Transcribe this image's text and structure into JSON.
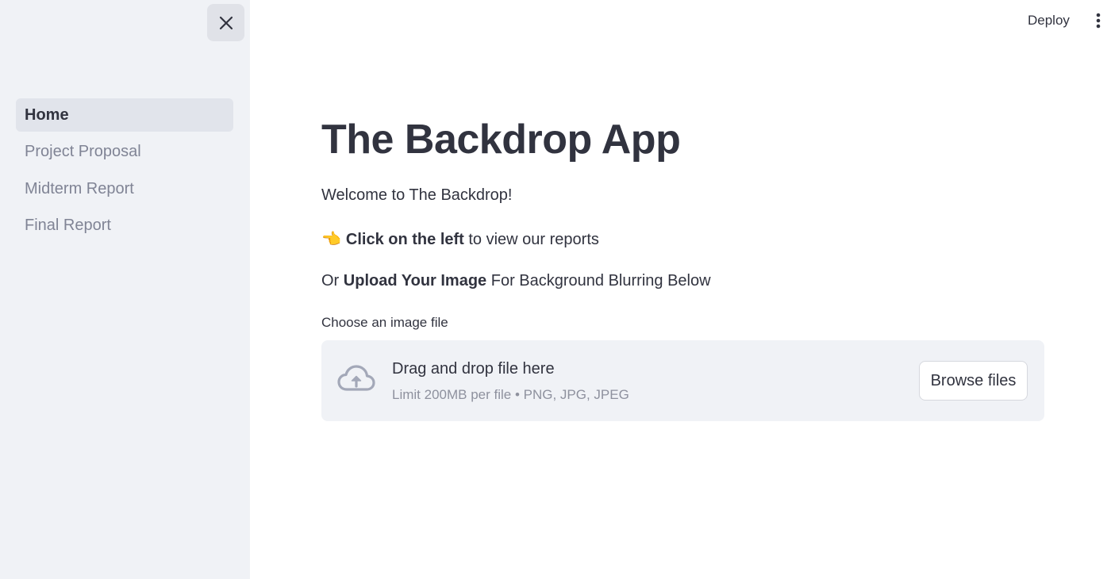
{
  "header": {
    "deploy_label": "Deploy"
  },
  "sidebar": {
    "items": [
      {
        "label": "Home",
        "active": true
      },
      {
        "label": "Project Proposal",
        "active": false
      },
      {
        "label": "Midterm Report",
        "active": false
      },
      {
        "label": "Final Report",
        "active": false
      }
    ]
  },
  "main": {
    "title": "The Backdrop App",
    "welcome": "Welcome to The Backdrop!",
    "hint_emoji": "👈",
    "hint_bold": "Click on the left",
    "hint_rest": " to view our reports",
    "upload_prefix": "Or ",
    "upload_bold": "Upload Your Image",
    "upload_rest": " For Background Blurring Below",
    "uploader": {
      "label": "Choose an image file",
      "drop_text": "Drag and drop file here",
      "limit_text": "Limit 200MB per file • PNG, JPG, JPEG",
      "browse_label": "Browse files"
    }
  },
  "colors": {
    "sidebar_bg": "#f0f2f6",
    "text": "#31333f",
    "muted_text": "#808495",
    "active_item_bg": "#e1e4eb",
    "cloud_icon": "#a3a8b8"
  },
  "icons": {
    "close": "close-icon",
    "menu": "kebab-menu-icon",
    "upload": "cloud-upload-icon"
  }
}
